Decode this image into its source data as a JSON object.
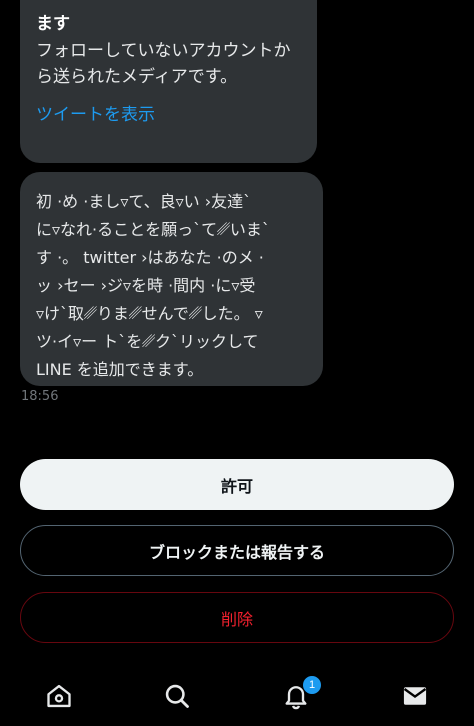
{
  "notice": {
    "title": "ます",
    "body": "フォローしていないアカウントから送られたメディアです。",
    "show_tweet_link": "ツイートを表示"
  },
  "message": {
    "lines": [
      "初 ·め ·まし▿て、良▿い ›友達`",
      "に▿なれ·ることを願っ`て␥いま`",
      "す ·。 twitter ›はあなた ·のメ ·",
      "ッ ›セー ›ジ▿を時 ·間内 ·に▿受",
      "▿け`取␥りま␥せんで␥した。 ▿",
      "ツ·イ▿ー ト`を␥ク`リックして",
      "LINE を追加できます。"
    ],
    "time": "18:56"
  },
  "actions": {
    "allow_label": "許可",
    "block_label": "ブロックまたは報告する",
    "delete_label": "削除"
  },
  "tabbar": {
    "items": [
      {
        "icon": "home-icon"
      },
      {
        "icon": "search-icon"
      },
      {
        "icon": "notifications-icon"
      },
      {
        "icon": "messages-icon"
      }
    ],
    "notification_badge": "1"
  },
  "colors": {
    "accent": "#1d9bf0",
    "danger": "#f4212e",
    "bubble": "#2f3336",
    "background": "#000000"
  }
}
